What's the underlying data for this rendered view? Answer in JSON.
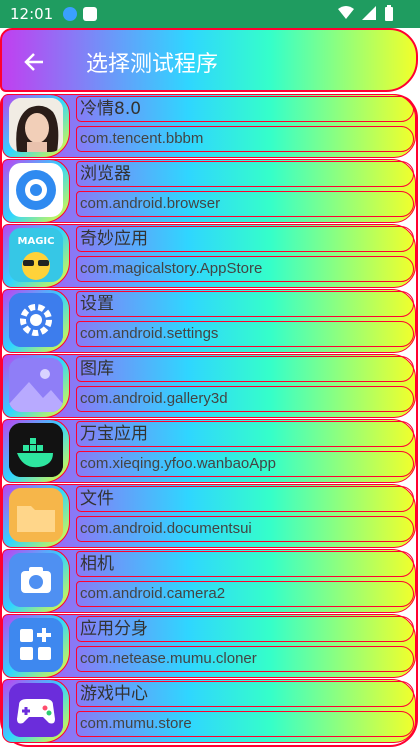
{
  "status": {
    "time": "12:01"
  },
  "appbar": {
    "title": "选择测试程序"
  },
  "apps": [
    {
      "name": "冷情8.0",
      "package": "com.tencent.bbbm",
      "icon": "avatar-photo-icon"
    },
    {
      "name": "浏览器",
      "package": "com.android.browser",
      "icon": "browser-icon"
    },
    {
      "name": "奇妙应用",
      "package": "com.magicalstory.AppStore",
      "icon": "magic-app-icon"
    },
    {
      "name": "设置",
      "package": "com.android.settings",
      "icon": "settings-gear-icon"
    },
    {
      "name": "图库",
      "package": "com.android.gallery3d",
      "icon": "gallery-icon"
    },
    {
      "name": "万宝应用",
      "package": "com.xieqing.yfoo.wanbaoApp",
      "icon": "docker-whale-icon"
    },
    {
      "name": "文件",
      "package": "com.android.documentsui",
      "icon": "folder-icon"
    },
    {
      "name": "相机",
      "package": "com.android.camera2",
      "icon": "camera-icon"
    },
    {
      "name": "应用分身",
      "package": "com.netease.mumu.cloner",
      "icon": "app-cloner-icon"
    },
    {
      "name": "游戏中心",
      "package": "com.mumu.store",
      "icon": "gamepad-icon"
    }
  ]
}
